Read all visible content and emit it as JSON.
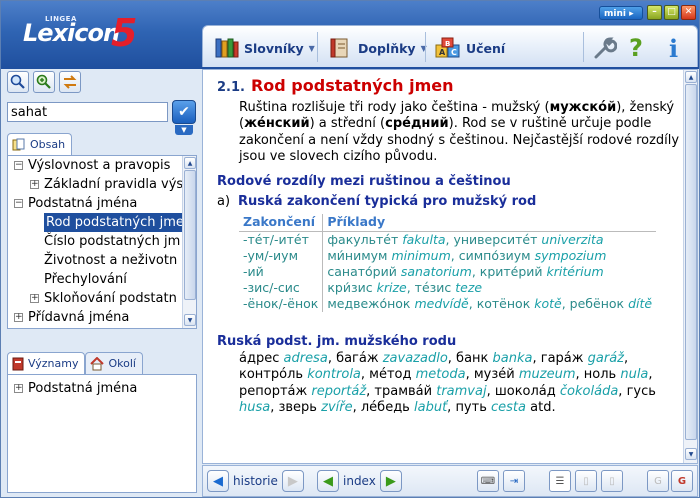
{
  "app": {
    "brand_small": "LINGEA",
    "brand_name": "Lexicon",
    "brand_version": "5",
    "mini_label": "mini"
  },
  "toolbar": {
    "dictionaries_label": "Slovníky",
    "addons_label": "Doplňky",
    "learning_label": "Učení",
    "help_label": "?",
    "info_label": "i"
  },
  "search": {
    "value": "sahat"
  },
  "tabs_top": [
    {
      "label": "Obsah"
    }
  ],
  "tree_top": [
    {
      "label": "Výslovnost a pravopis",
      "level": 0,
      "expander": "−",
      "selected": false
    },
    {
      "label": "Základní pravidla výs",
      "level": 1,
      "expander": "+",
      "selected": false
    },
    {
      "label": "Podstatná jména",
      "level": 0,
      "expander": "−",
      "selected": false
    },
    {
      "label": "Rod podstatných jmen",
      "level": 1,
      "expander": "",
      "selected": true
    },
    {
      "label": "Číslo podstatných jm",
      "level": 1,
      "expander": "",
      "selected": false
    },
    {
      "label": "Životnost a neživotn",
      "level": 1,
      "expander": "",
      "selected": false
    },
    {
      "label": "Přechylování",
      "level": 1,
      "expander": "",
      "selected": false
    },
    {
      "label": "Skloňování podstatn",
      "level": 1,
      "expander": "+",
      "selected": false
    },
    {
      "label": "Přídavná jména",
      "level": 0,
      "expander": "+",
      "selected": false
    }
  ],
  "tabs_bottom": [
    {
      "label": "Významy"
    },
    {
      "label": "Okolí"
    }
  ],
  "tree_bottom": [
    {
      "label": "Podstatná jména",
      "expander": "+"
    }
  ],
  "article": {
    "number": "2.1.",
    "title": "Rod podstatných jmen",
    "intro": {
      "t1": "Ruština rozlišuje tři rody jako čeština - mužský (",
      "b1": "мужско́й",
      "t2": "), ženský (",
      "b2": "же́нский",
      "t3": ") a střední (",
      "b3": "сре́дний",
      "t4": "). Rod se v ruštině určuje podle zakončení a není vždy shodný s češtinou. Nejčastější rodové rozdíly jsou ve slovech cizího původu."
    },
    "section1_title": "Rodové rozdíly mezi ruštinou a češtinou",
    "subsection_marker": "a)",
    "subsection_title": "Ruská zakončení typická pro mužský rod",
    "table_headers": [
      "Zakončení",
      "Příklady"
    ],
    "table_rows": [
      {
        "ending": "-тéт/-итéт",
        "w1": "факультéт",
        "c1": "fakulta",
        "w2": "университéт",
        "c2": "univerzita"
      },
      {
        "ending": "-ум/-иум",
        "w1": "ми́нимум",
        "c1": "minimum",
        "w2": "симпо́зиум",
        "c2": "sympozium"
      },
      {
        "ending": "-ий",
        "w1": "санато́рий",
        "c1": "sanatorium",
        "w2": "крите́рий",
        "c2": "kritérium"
      },
      {
        "ending": "-зис/-сис",
        "w1": "кри́зис",
        "c1": "krize",
        "w2": "тéзис",
        "c2": "teze"
      },
      {
        "ending": "-ёнок/-ёнок",
        "w1": "медвежо́нок",
        "c1": "medvídě",
        "w2": "котёнок",
        "c2": "kotě",
        "w3": "ребёнок",
        "c3": "dítě"
      }
    ],
    "section2_title": "Ruská podst. jm. mužského rodu",
    "words": [
      [
        {
          "w": "а́дрес",
          "c": "adresa"
        },
        {
          "w": "бага́ж",
          "c": "zavazadlo"
        },
        {
          "w": "банк",
          "c": "banka"
        },
        {
          "w": "гара́ж",
          "c": "garáž"
        },
        {
          "w": "контро́ль",
          "c": "kontrola"
        }
      ],
      [
        {
          "w": "ме́тод",
          "c": "metoda"
        },
        {
          "w": "музе́й",
          "c": "muzeum"
        },
        {
          "w": "ноль",
          "c": "nula"
        },
        {
          "w": "репорта́ж",
          "c": "reportáž"
        },
        {
          "w": "трамва́й",
          "c": "tramvaj"
        }
      ],
      [
        {
          "w": "шокола́д",
          "c": "čokoláda"
        },
        {
          "w": "гусь",
          "c": "husa"
        },
        {
          "w": "зверь",
          "c": "zvíře"
        },
        {
          "w": "ле́бедь",
          "c": "labuť"
        },
        {
          "w": "путь",
          "c": "cesta"
        }
      ]
    ],
    "etc": "atd."
  },
  "bottom": {
    "history_label": "historie",
    "index_label": "index"
  },
  "colors": {
    "header_blue": "#2f64b3",
    "title_red": "#cc0000",
    "section_blue": "#1a2e9a",
    "czech_teal": "#1aa0a8"
  }
}
